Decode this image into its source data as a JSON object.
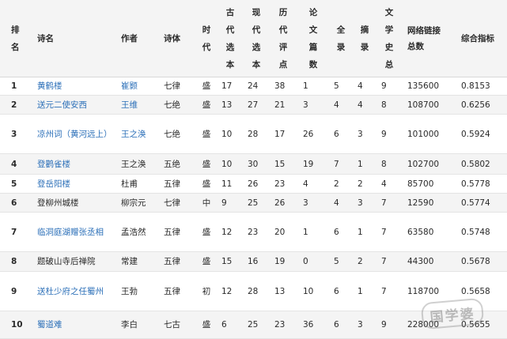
{
  "headers": {
    "rank": [
      "排",
      "名"
    ],
    "title": "诗名",
    "author": "作者",
    "form": "诗体",
    "era": [
      "时",
      "代"
    ],
    "ancient": [
      "古",
      "代",
      "选",
      "本"
    ],
    "modern": [
      "现",
      "代",
      "选",
      "本"
    ],
    "historical": [
      "历",
      "代",
      "评",
      "点"
    ],
    "papers": [
      "论",
      "文",
      "篇",
      "数"
    ],
    "recorded": [
      "全",
      "录"
    ],
    "abstract": [
      "摘",
      "录"
    ],
    "lit_history": [
      "文",
      "学",
      "史",
      "总"
    ],
    "network": [
      "网络链接",
      "总数"
    ],
    "score": "综合指标"
  },
  "rows": [
    {
      "rank": "1",
      "title": "黄鹤楼",
      "author": "崔颢",
      "form": "七律",
      "era": "盛",
      "ancient": "17",
      "modern": "24",
      "historical": "38",
      "papers": "1",
      "recorded": "5",
      "abstract": "4",
      "lit_history": "9",
      "network": "135600",
      "score": "0.8153"
    },
    {
      "rank": "2",
      "title": "送元二使安西",
      "author": "王维",
      "form": "七绝",
      "era": "盛",
      "ancient": "13",
      "modern": "27",
      "historical": "21",
      "papers": "3",
      "recorded": "4",
      "abstract": "4",
      "lit_history": "8",
      "network": "108700",
      "score": "0.6256"
    },
    {
      "rank": "3",
      "title": "凉州词（黄河远上）",
      "author": "王之涣",
      "form": "七绝",
      "era": "盛",
      "ancient": "10",
      "modern": "28",
      "historical": "17",
      "papers": "26",
      "recorded": "6",
      "abstract": "3",
      "lit_history": "9",
      "network": "101000",
      "score": "0.5924"
    },
    {
      "rank": "4",
      "title": "登鹳雀楼",
      "author": "王之涣",
      "form": "五绝",
      "era": "盛",
      "ancient": "10",
      "modern": "30",
      "historical": "15",
      "papers": "19",
      "recorded": "7",
      "abstract": "1",
      "lit_history": "8",
      "network": "102700",
      "score": "0.5802"
    },
    {
      "rank": "5",
      "title": "登岳阳楼",
      "author": "杜甫",
      "form": "五律",
      "era": "盛",
      "ancient": "11",
      "modern": "26",
      "historical": "23",
      "papers": "4",
      "recorded": "2",
      "abstract": "2",
      "lit_history": "4",
      "network": "85700",
      "score": "0.5778"
    },
    {
      "rank": "6",
      "title": "登柳州城楼",
      "author": "柳宗元",
      "form": "七律",
      "era": "中",
      "ancient": "9",
      "modern": "25",
      "historical": "26",
      "papers": "3",
      "recorded": "4",
      "abstract": "3",
      "lit_history": "7",
      "network": "12590",
      "score": "0.5774"
    },
    {
      "rank": "7",
      "title": "临洞庭湖赠张丞相",
      "author": "孟浩然",
      "form": "五律",
      "era": "盛",
      "ancient": "12",
      "modern": "23",
      "historical": "20",
      "papers": "1",
      "recorded": "6",
      "abstract": "1",
      "lit_history": "7",
      "network": "63580",
      "score": "0.5748"
    },
    {
      "rank": "8",
      "title": "题破山寺后禅院",
      "author": "常建",
      "form": "五律",
      "era": "盛",
      "ancient": "15",
      "modern": "16",
      "historical": "19",
      "papers": "0",
      "recorded": "5",
      "abstract": "2",
      "lit_history": "7",
      "network": "44300",
      "score": "0.5678"
    },
    {
      "rank": "9",
      "title": "送杜少府之任蜀州",
      "author": "王勃",
      "form": "五律",
      "era": "初",
      "ancient": "12",
      "modern": "28",
      "historical": "13",
      "papers": "10",
      "recorded": "6",
      "abstract": "1",
      "lit_history": "7",
      "network": "118700",
      "score": "0.5658"
    },
    {
      "rank": "10",
      "title": "蜀道难",
      "author": "李白",
      "form": "七古",
      "era": "盛",
      "ancient": "6",
      "modern": "25",
      "historical": "23",
      "papers": "36",
      "recorded": "6",
      "abstract": "3",
      "lit_history": "9",
      "network": "228000",
      "score": "0.5655"
    }
  ],
  "linked_titles": [
    true,
    true,
    true,
    true,
    true,
    false,
    true,
    false,
    true,
    true
  ],
  "linked_authors": [
    true,
    true,
    true,
    false,
    false,
    false,
    false,
    false,
    false,
    false
  ],
  "seal_text": "国学婆",
  "colors": {
    "link": "#2b6fb8",
    "text": "#2a2a2a",
    "stripe": "#f4f4f4",
    "border": "#e4e4e4"
  }
}
